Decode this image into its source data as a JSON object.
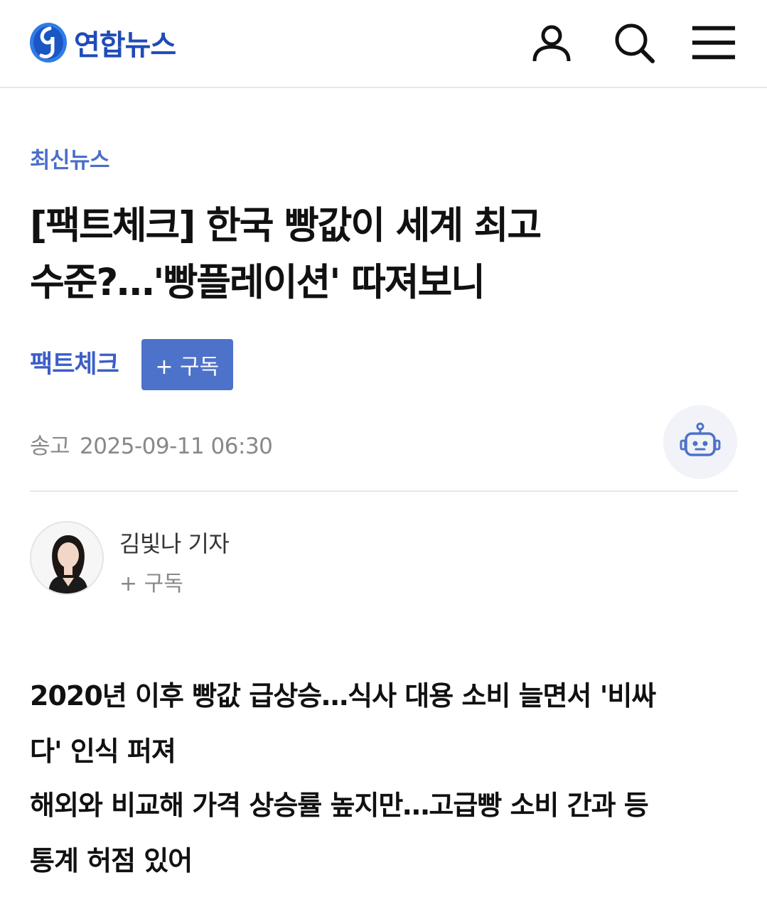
{
  "header": {
    "logo_text": "연합뉴스",
    "icons": [
      "person-icon",
      "search-icon",
      "menu-icon"
    ],
    "brand_color": "#1f4bb8"
  },
  "category": "최신뉴스",
  "headline": {
    "line1": "[팩트체크] 한국 빵값이 세계 최고",
    "line2": "수준?…'빵플레이션' 따져보니"
  },
  "series": {
    "tag": "팩트체크",
    "subscribe_label": "+ 구독"
  },
  "dateline": {
    "label": "송고",
    "datetime": "2025-09-11 06:30"
  },
  "author": {
    "name": "김빛나 기자",
    "subscribe_label": "+ 구독"
  },
  "summary": [
    {
      "line1": "2020년 이후 빵값 급상승…식사 대용 소비 늘면서 '비싸",
      "line2": "다' 인식 퍼져"
    },
    {
      "line1": "해외와 비교해 가격 상승률 높지만…고급빵 소비 간과 등",
      "line2": "통계 허점 있어"
    }
  ]
}
